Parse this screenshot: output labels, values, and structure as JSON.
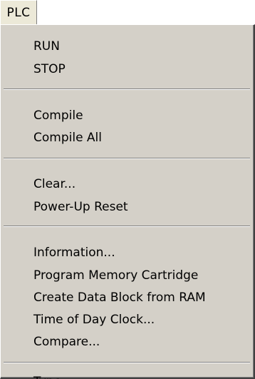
{
  "menubar": {
    "title": "PLC"
  },
  "menu": {
    "groups": [
      {
        "items": [
          {
            "label": "RUN"
          },
          {
            "label": "STOP"
          }
        ]
      },
      {
        "items": [
          {
            "label": "Compile"
          },
          {
            "label": "Compile All"
          }
        ]
      },
      {
        "items": [
          {
            "label": "Clear..."
          },
          {
            "label": "Power-Up Reset"
          }
        ]
      },
      {
        "items": [
          {
            "label": "Information..."
          },
          {
            "label": "Program Memory Cartridge"
          },
          {
            "label": "Create Data Block from RAM"
          },
          {
            "label": "Time of Day Clock..."
          },
          {
            "label": "Compare..."
          }
        ]
      },
      {
        "items": [
          {
            "label": "Type..."
          }
        ]
      }
    ]
  },
  "colors": {
    "menu_background": "#d4d0c8",
    "menubar_background": "#ece9d8",
    "separator_dark": "#808080",
    "separator_light": "#ffffff",
    "text": "#000000"
  }
}
